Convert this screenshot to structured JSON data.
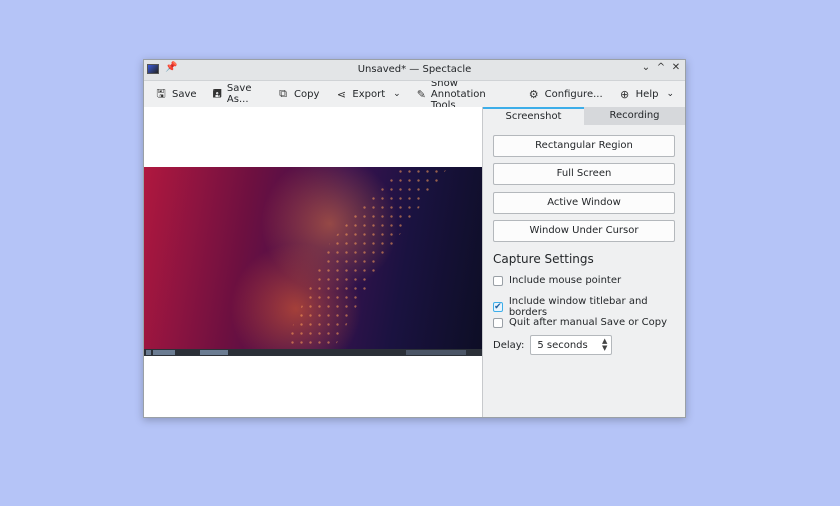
{
  "window": {
    "title": "Unsaved* — Spectacle"
  },
  "titlebar_controls": [
    "⌄",
    "^",
    "✕"
  ],
  "toolbar": {
    "save": "Save",
    "save_as": "Save As...",
    "copy": "Copy",
    "export": "Export",
    "annotate": "Show Annotation Tools",
    "configure": "Configure...",
    "help": "Help"
  },
  "tabs": {
    "screenshot": "Screenshot",
    "recording": "Recording"
  },
  "capture_buttons": {
    "rectangular": "Rectangular Region",
    "full_screen": "Full Screen",
    "active_window": "Active Window",
    "under_cursor": "Window Under Cursor"
  },
  "settings": {
    "title": "Capture Settings",
    "mouse_pointer": {
      "label": "Include mouse pointer",
      "checked": false
    },
    "titlebar": {
      "label": "Include window titlebar and borders",
      "checked": true
    },
    "quit_after": {
      "label": "Quit after manual Save or Copy",
      "checked": false
    },
    "delay_label": "Delay:",
    "delay_value": "5 seconds"
  },
  "colors": {
    "accent": "#3daee9",
    "background": "#b5c4f7"
  }
}
